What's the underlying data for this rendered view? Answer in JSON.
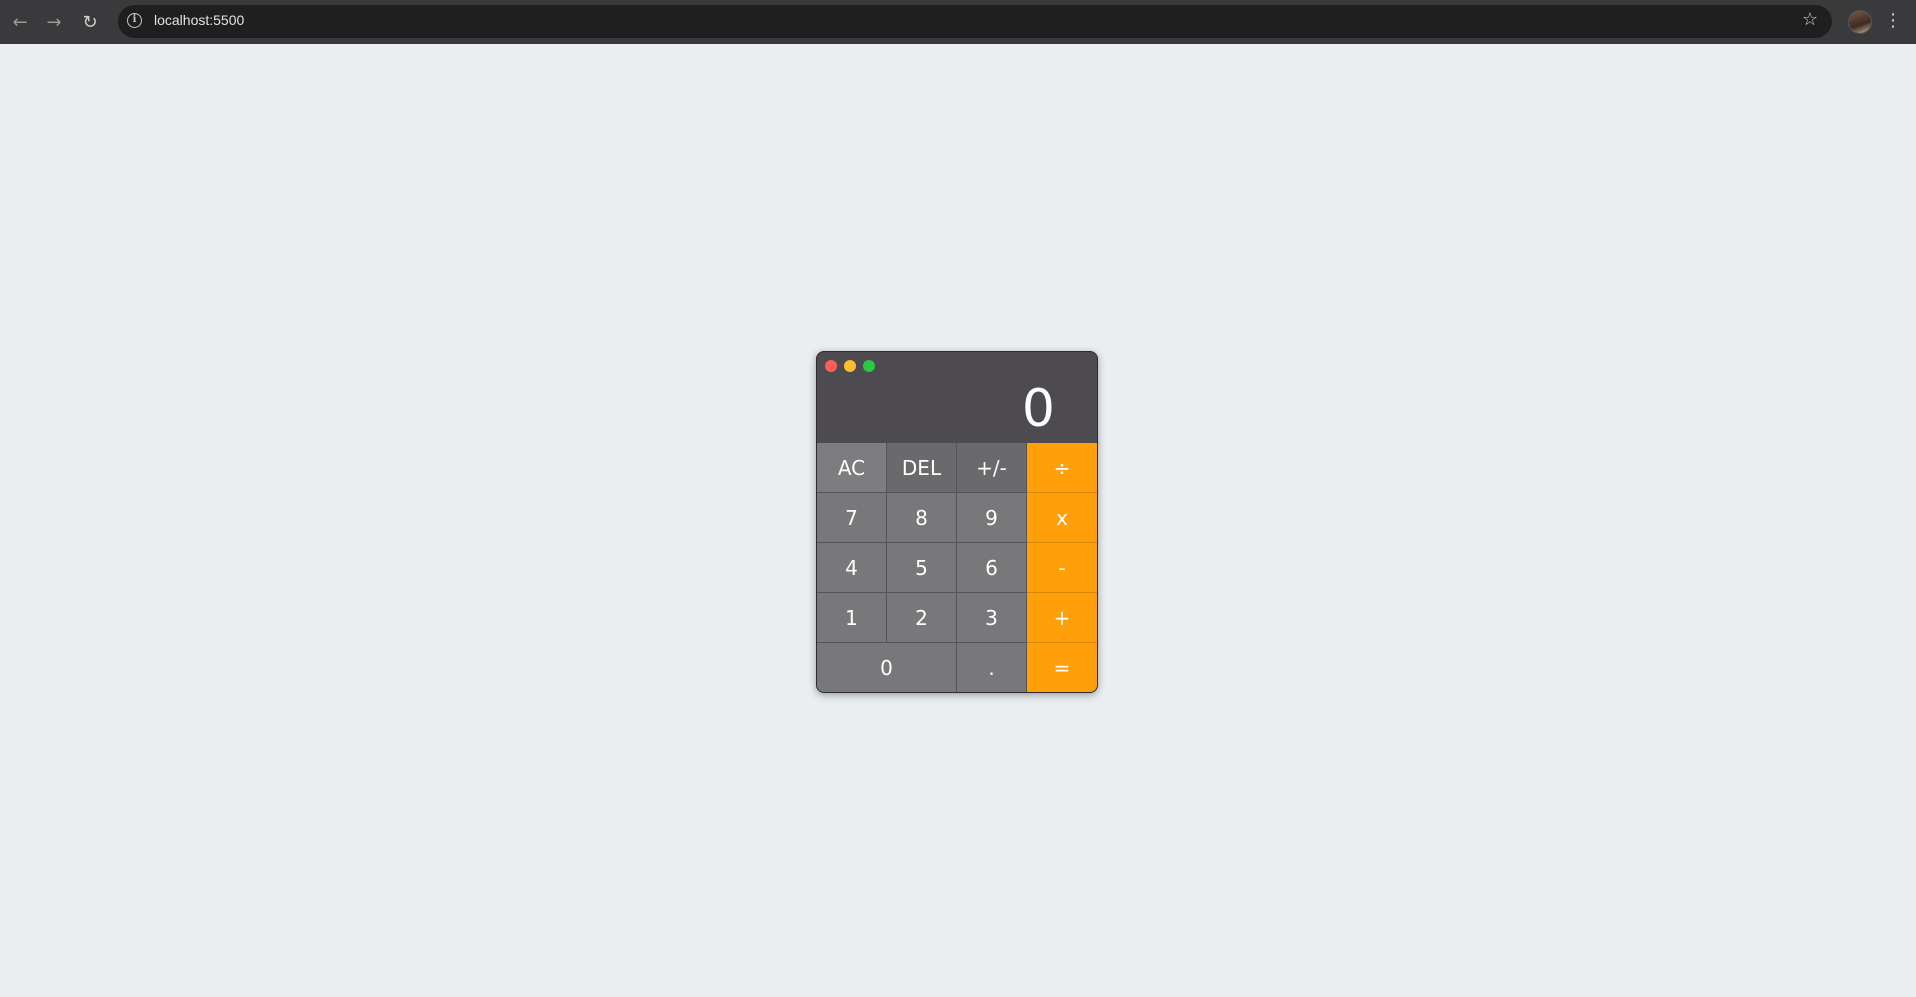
{
  "browser": {
    "url": "localhost:5500",
    "back_icon": "arrow-left-icon",
    "forward_icon": "arrow-right-icon",
    "reload_icon": "reload-icon"
  },
  "calculator": {
    "display": "0",
    "window_controls": [
      "close",
      "minimize",
      "maximize"
    ],
    "rows": [
      [
        "AC",
        "DEL",
        "+/-",
        "÷"
      ],
      [
        "7",
        "8",
        "9",
        "x"
      ],
      [
        "4",
        "5",
        "6",
        "-"
      ],
      [
        "1",
        "2",
        "3",
        "+"
      ],
      [
        "0",
        ".",
        "="
      ]
    ]
  },
  "colors": {
    "accent": "#ff9f0a",
    "key": "#78787a",
    "display_bg": "#4d4a50",
    "page_bg": "#eaeef1"
  }
}
